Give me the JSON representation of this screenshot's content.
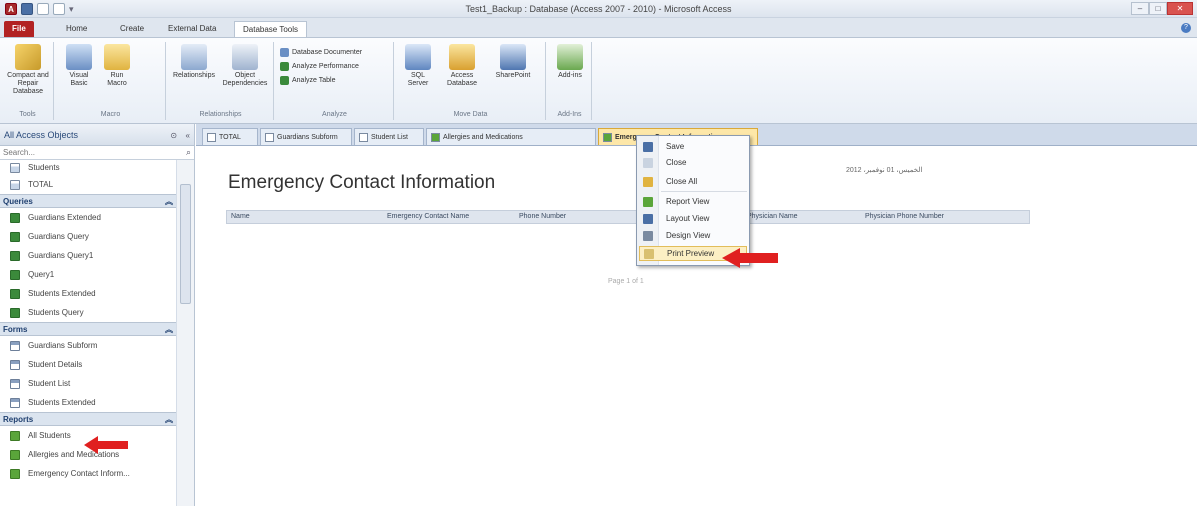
{
  "window": {
    "title": "Test1_Backup : Database (Access 2007 - 2010) - Microsoft Access",
    "app_icon": "A",
    "controls": [
      "minimize",
      "maximize",
      "close"
    ]
  },
  "ribbon_tabs": [
    {
      "label": "File"
    },
    {
      "label": "Home"
    },
    {
      "label": "Create"
    },
    {
      "label": "External Data"
    },
    {
      "label": "Database Tools"
    }
  ],
  "ribbon": {
    "groups": [
      {
        "label": "Tools",
        "buttons": [
          "Compact and Repair Database"
        ]
      },
      {
        "label": "Macro",
        "buttons": [
          "Visual Basic",
          "Run Macro"
        ]
      },
      {
        "label": "Relationships",
        "buttons": [
          "Relationships",
          "Object Dependencies"
        ]
      },
      {
        "label": "Analyze",
        "buttons": [
          "Database Documenter",
          "Analyze Performance",
          "Analyze Table"
        ]
      },
      {
        "label": "Move Data",
        "buttons": [
          "SQL Server",
          "Access Database",
          "SharePoint"
        ]
      },
      {
        "label": "Add-Ins",
        "buttons": [
          "Add-ins"
        ]
      }
    ]
  },
  "nav": {
    "title": "All Access Objects",
    "search_placeholder": "Search...",
    "tables_tail": [
      "Students",
      "TOTAL"
    ],
    "groups": [
      {
        "label": "Queries",
        "type": "query",
        "items": [
          "Guardians Extended",
          "Guardians Query",
          "Guardians Query1",
          "Query1",
          "Students Extended",
          "Students Query"
        ]
      },
      {
        "label": "Forms",
        "type": "form",
        "items": [
          "Guardians Subform",
          "Student Details",
          "Student List",
          "Students Extended"
        ]
      },
      {
        "label": "Reports",
        "type": "report",
        "items": [
          "All Students",
          "Allergies and Medications",
          "Emergency Contact Inform..."
        ]
      }
    ]
  },
  "doc_tabs": [
    {
      "label": "TOTAL"
    },
    {
      "label": "Guardians Subform"
    },
    {
      "label": "Student List"
    },
    {
      "label": "Allergies and Medications"
    },
    {
      "label": "Emergency Contact Information",
      "active": true
    }
  ],
  "report": {
    "title": "Emergency Contact Information",
    "date_text": "الخميس، 01 نوفمبر، 2012",
    "columns": [
      "Name",
      "Emergency Contact Name",
      "Phone Number",
      "Physician Name",
      "Physician Phone Number"
    ],
    "footer": "Page 1 of 1"
  },
  "context_menu": {
    "items": [
      "Save",
      "Close",
      "Close All",
      "Report View",
      "Layout View",
      "Design View",
      "Print Preview"
    ],
    "highlighted": "Print Preview"
  },
  "colors": {
    "accent": "#b22222",
    "annotation_arrow": "#e02020",
    "highlight": "#fcefc4"
  }
}
